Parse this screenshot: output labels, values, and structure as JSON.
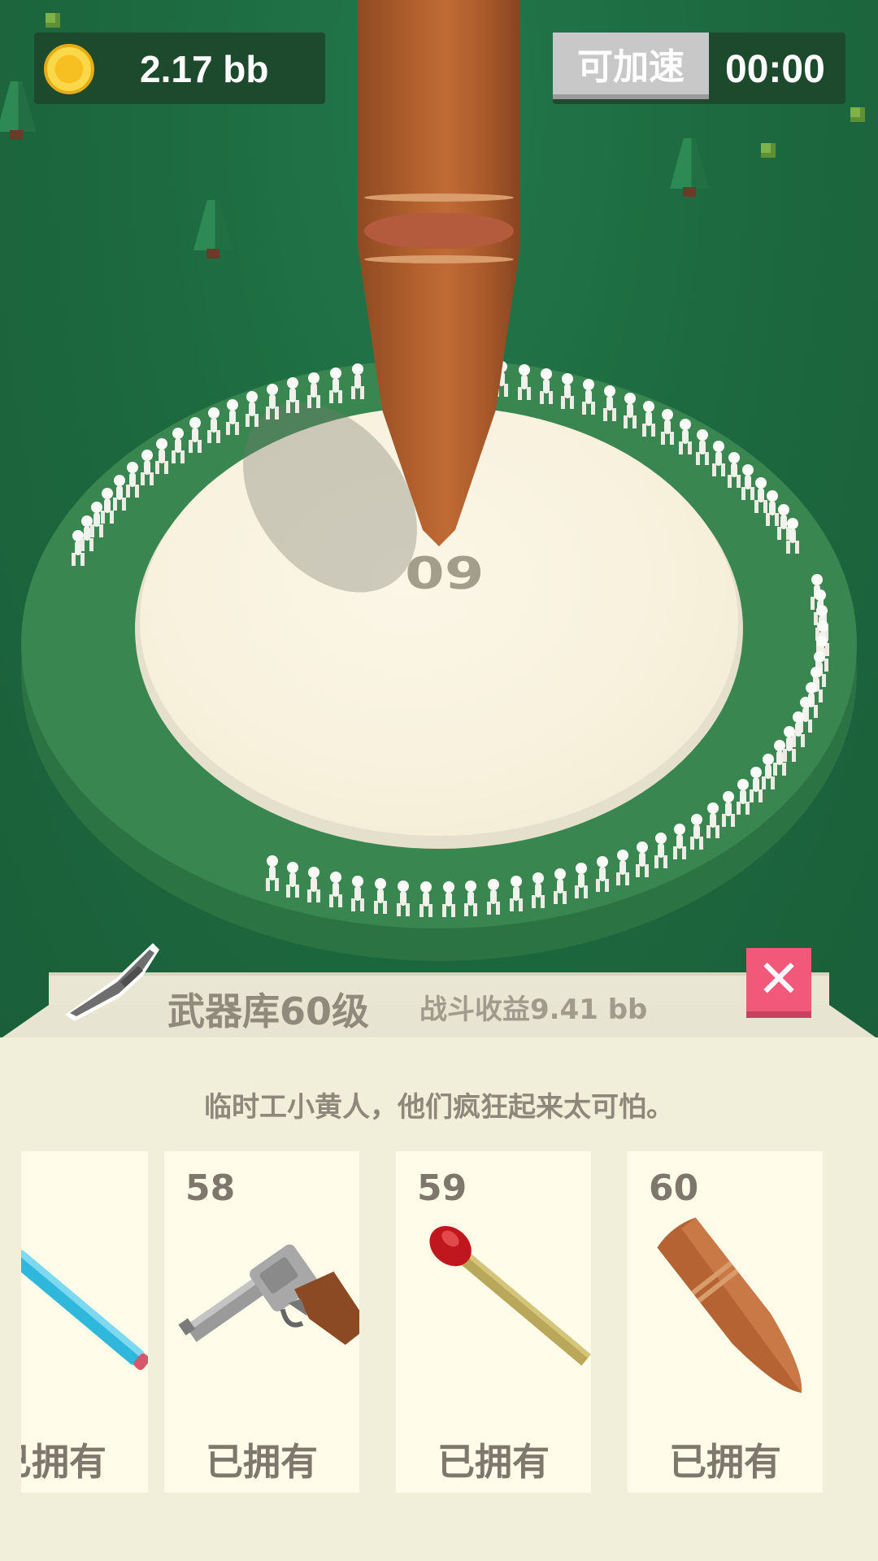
{
  "hud": {
    "coins": "2.17 bb",
    "coin_icon": "gold-coin-icon",
    "speed_up_label": "可加速",
    "timer": "00:00"
  },
  "arena": {
    "level_number": "60"
  },
  "panel": {
    "title": "武器库60级",
    "battle_earnings": "战斗收益9.41 bb",
    "description": "临时工小黄人，他们疯狂起来太可怕。",
    "close_icon": "close-x-icon",
    "header_icon": "knife-icon",
    "cards": [
      {
        "level": "",
        "status": "已拥有",
        "icon": "pencil-icon"
      },
      {
        "level": "58",
        "status": "已拥有",
        "icon": "revolver-icon"
      },
      {
        "level": "59",
        "status": "已拥有",
        "icon": "matchstick-icon"
      },
      {
        "level": "60",
        "status": "已拥有",
        "icon": "bullet-icon"
      }
    ]
  },
  "colors": {
    "grass": "#1f6b3f",
    "ring": "#3a8650",
    "pad": "#f7f1dc",
    "panel": "#f1efd9",
    "close": "#f1587a",
    "speed_button": "#c8c8c8"
  }
}
